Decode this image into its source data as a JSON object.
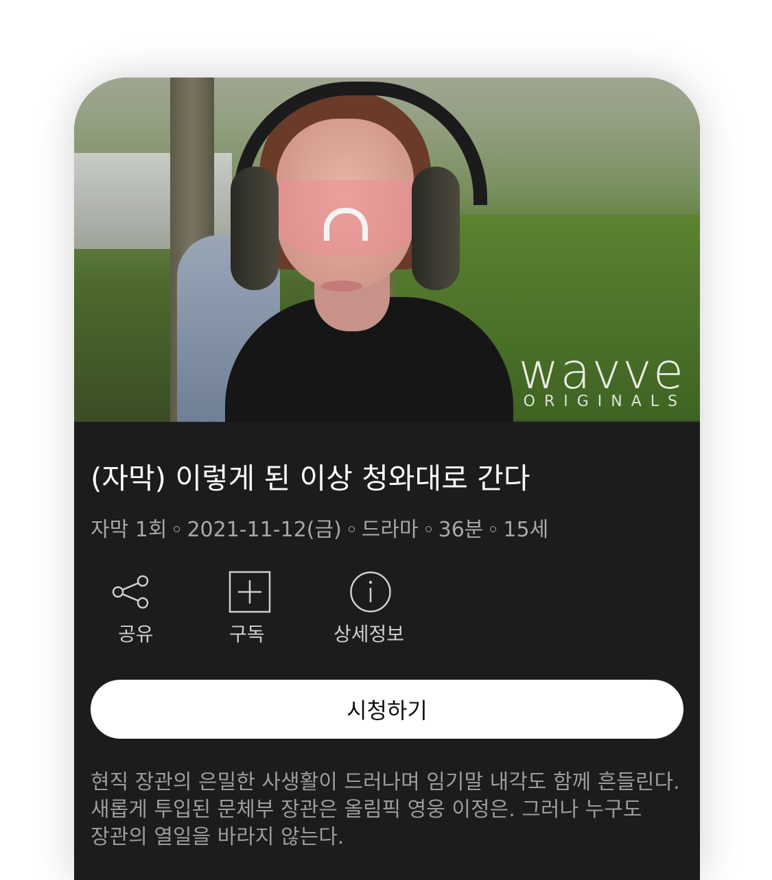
{
  "hero": {
    "logo_word": "wavve",
    "logo_sub": "ORIGINALS"
  },
  "program": {
    "title": "(자막) 이렇게 된 이상 청와대로 간다",
    "meta": [
      "자막 1회",
      "2021-11-12(금)",
      "드라마",
      "36분",
      "15세"
    ],
    "description": "현직 장관의 은밀한 사생활이 드러나며 임기말 내각도 함께 흔들린다. 새롭게 투입된 문체부 장관은 올림픽 영웅 이정은. 그러나 누구도 장관의 열일을 바라지 않는다."
  },
  "actions": {
    "share_label": "공유",
    "subscribe_label": "구독",
    "info_label": "상세정보"
  },
  "watch_button": {
    "label": "시청하기"
  },
  "colors": {
    "panel_bg": "#1c1c1c",
    "title_text": "#ffffff",
    "meta_text": "#a8a8a8",
    "button_bg": "#ffffff"
  },
  "icons": [
    "share-icon",
    "plus-box-icon",
    "info-circle-icon"
  ]
}
